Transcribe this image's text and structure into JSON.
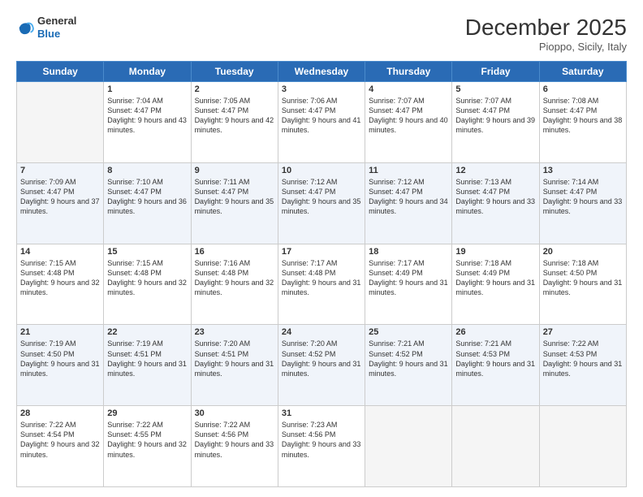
{
  "logo": {
    "general": "General",
    "blue": "Blue"
  },
  "header": {
    "month": "December 2025",
    "location": "Pioppo, Sicily, Italy"
  },
  "weekdays": [
    "Sunday",
    "Monday",
    "Tuesday",
    "Wednesday",
    "Thursday",
    "Friday",
    "Saturday"
  ],
  "weeks": [
    [
      {
        "day": "",
        "empty": true
      },
      {
        "day": "1",
        "sunrise": "7:04 AM",
        "sunset": "4:47 PM",
        "daylight": "9 hours and 43 minutes."
      },
      {
        "day": "2",
        "sunrise": "7:05 AM",
        "sunset": "4:47 PM",
        "daylight": "9 hours and 42 minutes."
      },
      {
        "day": "3",
        "sunrise": "7:06 AM",
        "sunset": "4:47 PM",
        "daylight": "9 hours and 41 minutes."
      },
      {
        "day": "4",
        "sunrise": "7:07 AM",
        "sunset": "4:47 PM",
        "daylight": "9 hours and 40 minutes."
      },
      {
        "day": "5",
        "sunrise": "7:07 AM",
        "sunset": "4:47 PM",
        "daylight": "9 hours and 39 minutes."
      },
      {
        "day": "6",
        "sunrise": "7:08 AM",
        "sunset": "4:47 PM",
        "daylight": "9 hours and 38 minutes."
      }
    ],
    [
      {
        "day": "7",
        "sunrise": "7:09 AM",
        "sunset": "4:47 PM",
        "daylight": "9 hours and 37 minutes."
      },
      {
        "day": "8",
        "sunrise": "7:10 AM",
        "sunset": "4:47 PM",
        "daylight": "9 hours and 36 minutes."
      },
      {
        "day": "9",
        "sunrise": "7:11 AM",
        "sunset": "4:47 PM",
        "daylight": "9 hours and 35 minutes."
      },
      {
        "day": "10",
        "sunrise": "7:12 AM",
        "sunset": "4:47 PM",
        "daylight": "9 hours and 35 minutes."
      },
      {
        "day": "11",
        "sunrise": "7:12 AM",
        "sunset": "4:47 PM",
        "daylight": "9 hours and 34 minutes."
      },
      {
        "day": "12",
        "sunrise": "7:13 AM",
        "sunset": "4:47 PM",
        "daylight": "9 hours and 33 minutes."
      },
      {
        "day": "13",
        "sunrise": "7:14 AM",
        "sunset": "4:47 PM",
        "daylight": "9 hours and 33 minutes."
      }
    ],
    [
      {
        "day": "14",
        "sunrise": "7:15 AM",
        "sunset": "4:48 PM",
        "daylight": "9 hours and 32 minutes."
      },
      {
        "day": "15",
        "sunrise": "7:15 AM",
        "sunset": "4:48 PM",
        "daylight": "9 hours and 32 minutes."
      },
      {
        "day": "16",
        "sunrise": "7:16 AM",
        "sunset": "4:48 PM",
        "daylight": "9 hours and 32 minutes."
      },
      {
        "day": "17",
        "sunrise": "7:17 AM",
        "sunset": "4:48 PM",
        "daylight": "9 hours and 31 minutes."
      },
      {
        "day": "18",
        "sunrise": "7:17 AM",
        "sunset": "4:49 PM",
        "daylight": "9 hours and 31 minutes."
      },
      {
        "day": "19",
        "sunrise": "7:18 AM",
        "sunset": "4:49 PM",
        "daylight": "9 hours and 31 minutes."
      },
      {
        "day": "20",
        "sunrise": "7:18 AM",
        "sunset": "4:50 PM",
        "daylight": "9 hours and 31 minutes."
      }
    ],
    [
      {
        "day": "21",
        "sunrise": "7:19 AM",
        "sunset": "4:50 PM",
        "daylight": "9 hours and 31 minutes."
      },
      {
        "day": "22",
        "sunrise": "7:19 AM",
        "sunset": "4:51 PM",
        "daylight": "9 hours and 31 minutes."
      },
      {
        "day": "23",
        "sunrise": "7:20 AM",
        "sunset": "4:51 PM",
        "daylight": "9 hours and 31 minutes."
      },
      {
        "day": "24",
        "sunrise": "7:20 AM",
        "sunset": "4:52 PM",
        "daylight": "9 hours and 31 minutes."
      },
      {
        "day": "25",
        "sunrise": "7:21 AM",
        "sunset": "4:52 PM",
        "daylight": "9 hours and 31 minutes."
      },
      {
        "day": "26",
        "sunrise": "7:21 AM",
        "sunset": "4:53 PM",
        "daylight": "9 hours and 31 minutes."
      },
      {
        "day": "27",
        "sunrise": "7:22 AM",
        "sunset": "4:53 PM",
        "daylight": "9 hours and 31 minutes."
      }
    ],
    [
      {
        "day": "28",
        "sunrise": "7:22 AM",
        "sunset": "4:54 PM",
        "daylight": "9 hours and 32 minutes."
      },
      {
        "day": "29",
        "sunrise": "7:22 AM",
        "sunset": "4:55 PM",
        "daylight": "9 hours and 32 minutes."
      },
      {
        "day": "30",
        "sunrise": "7:22 AM",
        "sunset": "4:56 PM",
        "daylight": "9 hours and 33 minutes."
      },
      {
        "day": "31",
        "sunrise": "7:23 AM",
        "sunset": "4:56 PM",
        "daylight": "9 hours and 33 minutes."
      },
      {
        "day": "",
        "empty": true
      },
      {
        "day": "",
        "empty": true
      },
      {
        "day": "",
        "empty": true
      }
    ]
  ]
}
